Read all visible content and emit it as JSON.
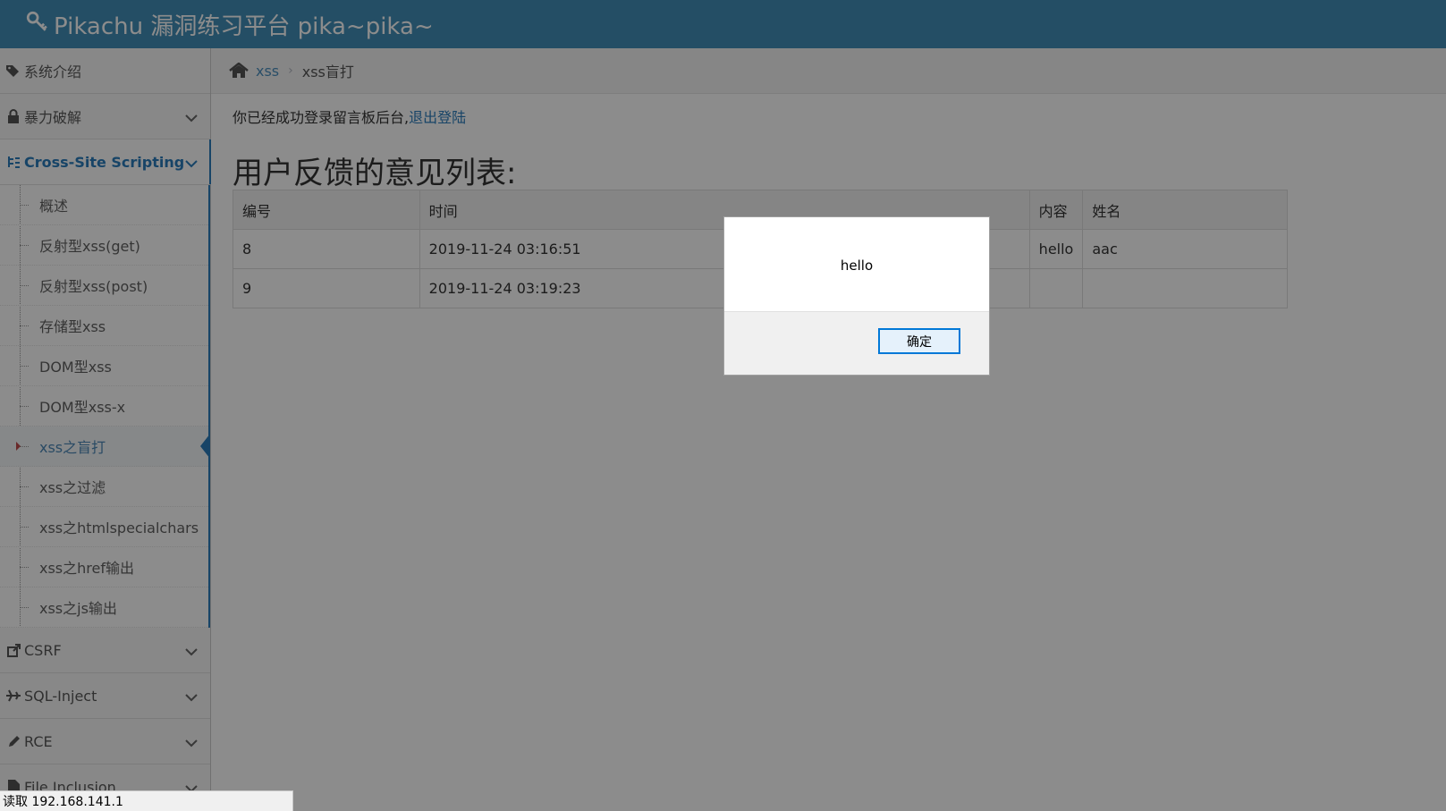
{
  "app": {
    "title": "Pikachu 漏洞练习平台 pika~pika~"
  },
  "sidebar": {
    "top_items": [
      {
        "label": "系统介绍",
        "icon": "tags-icon"
      },
      {
        "label": "暴力破解",
        "icon": "lock-icon"
      }
    ],
    "active_group": {
      "label": "Cross-Site Scripting",
      "icon": "sitemap-icon"
    },
    "xss_items": [
      "概述",
      "反射型xss(get)",
      "反射型xss(post)",
      "存储型xss",
      "DOM型xss",
      "DOM型xss-x",
      "xss之盲打",
      "xss之过滤",
      "xss之htmlspecialchars",
      "xss之href输出",
      "xss之js输出"
    ],
    "current_item": "xss之盲打",
    "bottom_items": [
      {
        "label": "CSRF",
        "icon": "share-icon"
      },
      {
        "label": "SQL-Inject",
        "icon": "plane-icon"
      },
      {
        "label": "RCE",
        "icon": "pencil-icon"
      },
      {
        "label": "File Inclusion",
        "icon": "file-icon"
      }
    ]
  },
  "breadcrumb": {
    "parent": "xss",
    "current": "xss盲打"
  },
  "content": {
    "login_text": "你已经成功登录留言板后台,",
    "logout_link": "退出登陆",
    "title": "用户反馈的意见列表:",
    "table": {
      "headers": [
        "编号",
        "时间",
        "",
        "内容",
        "姓名"
      ],
      "rows": [
        [
          "8",
          "2019-11-24 03:16:51",
          "",
          "hello",
          "aac"
        ],
        [
          "9",
          "2019-11-24 03:19:23",
          "",
          "",
          ""
        ]
      ]
    }
  },
  "dialog": {
    "message": "hello",
    "ok_label": "确定"
  },
  "statusbar": {
    "text": "读取 192.168.141.1"
  },
  "colors": {
    "header": "#438eb9",
    "accent": "#2b7dbc",
    "overlay": "rgba(0,0,0,0.45)"
  }
}
